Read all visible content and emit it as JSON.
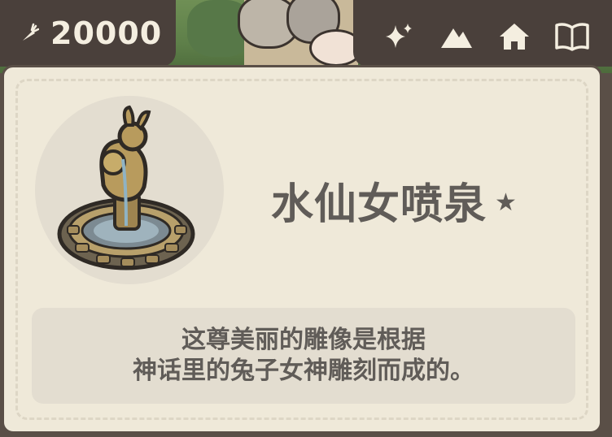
{
  "currency": {
    "icon": "carrot-icon",
    "amount": "20000"
  },
  "toolbar": {
    "buttons": [
      {
        "icon": "sparkle-icon"
      },
      {
        "icon": "mountain-icon"
      },
      {
        "icon": "home-icon"
      },
      {
        "icon": "book-icon"
      }
    ]
  },
  "item": {
    "image": "fountain-statue-icon",
    "name": "水仙女喷泉",
    "star": "★",
    "description_lines": [
      "这尊美丽的雕像是根据",
      "神话里的兔子女神雕刻而成的。"
    ]
  },
  "colors": {
    "bar_bg": "#4a403b",
    "card_bg": "#efe9d9",
    "text": "#605c58",
    "light_text": "#f4eee0"
  }
}
